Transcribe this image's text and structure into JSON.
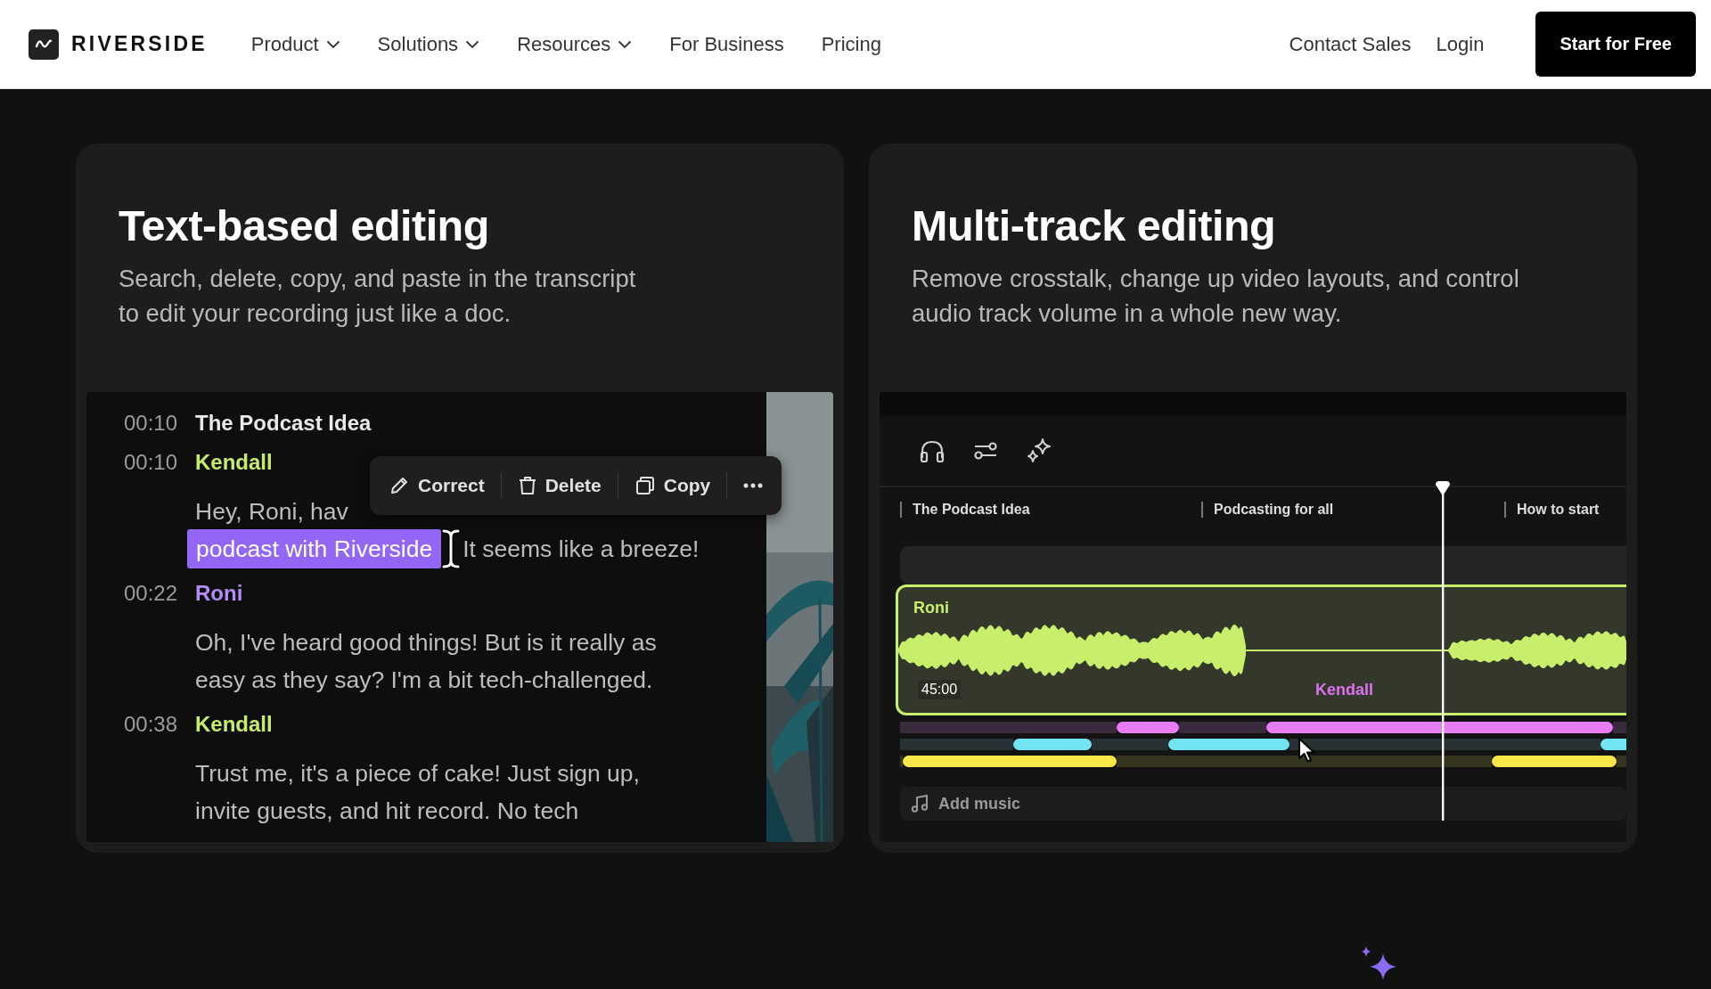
{
  "header": {
    "brand": "RIVERSIDE",
    "nav": [
      {
        "label": "Product",
        "has_menu": true
      },
      {
        "label": "Solutions",
        "has_menu": true
      },
      {
        "label": "Resources",
        "has_menu": true
      },
      {
        "label": "For Business",
        "has_menu": false
      },
      {
        "label": "Pricing",
        "has_menu": false
      }
    ],
    "links": [
      "Contact Sales",
      "Login"
    ],
    "cta": "Start for Free"
  },
  "transcript_card": {
    "title": "Text-based editing",
    "subtitle": "Search, delete, copy, and paste in the transcript\nto edit your recording just like a doc.",
    "entries": [
      {
        "time": "00:10",
        "kind": "chapter",
        "heading": "The Podcast Idea"
      },
      {
        "time": "00:10",
        "kind": "speaker",
        "heading": "Kendall",
        "color": "#c6ec6e",
        "lines": [
          [
            {
              "text": "Hey, Roni, hav",
              "selected": false
            }
          ],
          [
            {
              "text": "podcast with Riverside",
              "selected": true
            },
            {
              "text": "It seems like a breeze!",
              "selected": false
            }
          ]
        ]
      },
      {
        "time": "00:22",
        "kind": "speaker",
        "heading": "Roni",
        "color": "#b48cf7",
        "lines": [
          [
            {
              "text": "Oh, I've heard good things! But is it really as",
              "selected": false
            }
          ],
          [
            {
              "text": "easy as they say? I'm a bit tech-challenged.",
              "selected": false
            }
          ]
        ]
      },
      {
        "time": "00:38",
        "kind": "speaker",
        "heading": "Kendall",
        "color": "#c6ec6e",
        "lines": [
          [
            {
              "text": "Trust me, it's a piece of cake! Just sign up,",
              "selected": false
            }
          ],
          [
            {
              "text": "invite guests, and hit record. No tech",
              "selected": false
            }
          ]
        ]
      }
    ],
    "toolbar": [
      "Correct",
      "Delete",
      "Copy"
    ]
  },
  "timeline_card": {
    "title": "Multi-track editing",
    "subtitle": "Remove crosstalk, change up video layouts, and control\naudio track volume in a whole new way.",
    "chapters": [
      "The Podcast Idea",
      "Podcasting for all",
      "How to start"
    ],
    "track": {
      "name": "Roni",
      "color": "#c8ef6c",
      "time": "45:00"
    },
    "next_speaker": {
      "name": "Kendall",
      "color": "#dd72f0"
    },
    "lanes": [
      {
        "color": "#e77cf4"
      },
      {
        "color": "#71e4f2"
      },
      {
        "color": "#f9e649"
      }
    ],
    "add_music": "Add music"
  }
}
